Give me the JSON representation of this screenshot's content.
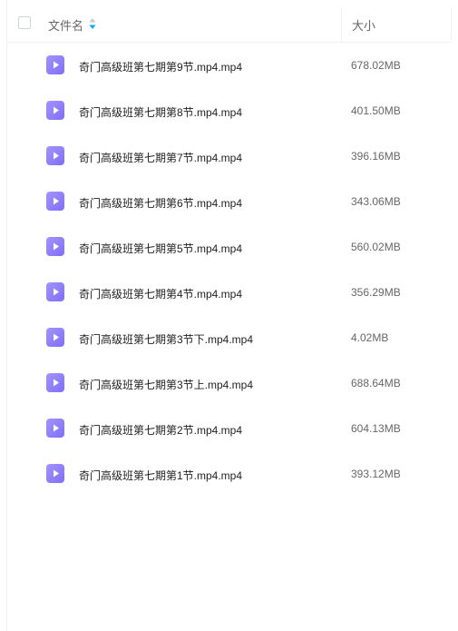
{
  "header": {
    "name_label": "文件名",
    "size_label": "大小"
  },
  "files": [
    {
      "name": "奇门高级班第七期第9节.mp4.mp4",
      "size": "678.02MB"
    },
    {
      "name": "奇门高级班第七期第8节.mp4.mp4",
      "size": "401.50MB"
    },
    {
      "name": "奇门高级班第七期第7节.mp4.mp4",
      "size": "396.16MB"
    },
    {
      "name": "奇门高级班第七期第6节.mp4.mp4",
      "size": "343.06MB"
    },
    {
      "name": "奇门高级班第七期第5节.mp4.mp4",
      "size": "560.02MB"
    },
    {
      "name": "奇门高级班第七期第4节.mp4.mp4",
      "size": "356.29MB"
    },
    {
      "name": "奇门高级班第七期第3节下.mp4.mp4",
      "size": "4.02MB"
    },
    {
      "name": "奇门高级班第七期第3节上.mp4.mp4",
      "size": "688.64MB"
    },
    {
      "name": "奇门高级班第七期第2节.mp4.mp4",
      "size": "604.13MB"
    },
    {
      "name": "奇门高级班第七期第1节.mp4.mp4",
      "size": "393.12MB"
    }
  ],
  "icons": {
    "file": "video-file-icon",
    "sort": "sort-icon",
    "checkbox": "checkbox-icon"
  },
  "colors": {
    "icon_accent": "#8b7cff",
    "sort_active": "#06a7ff"
  }
}
